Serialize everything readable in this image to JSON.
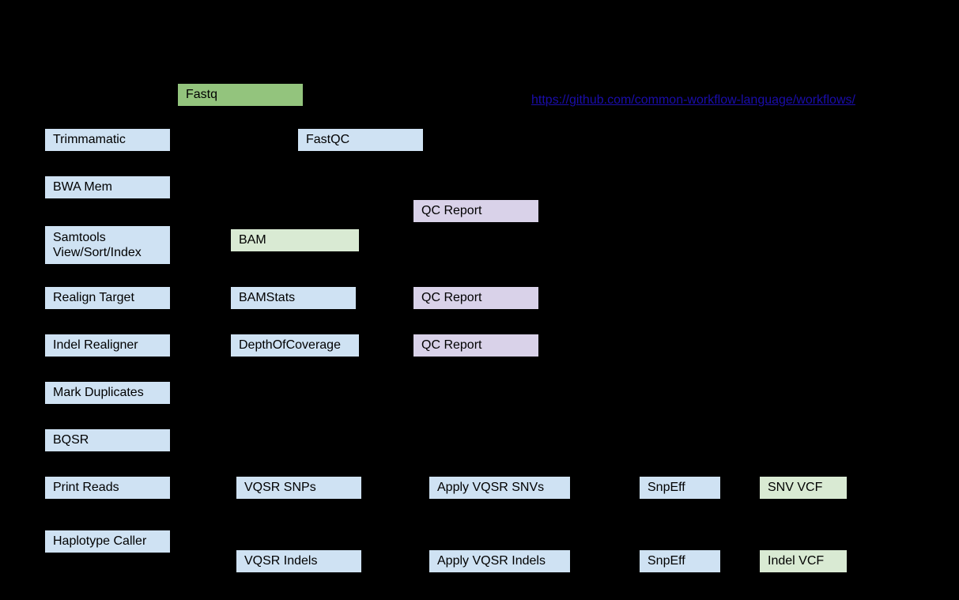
{
  "link": "https://github.com/common-workflow-language/workflows/",
  "nodes": {
    "fastq": "Fastq",
    "trimmamatic": "Trimmamatic",
    "fastqc": "FastQC",
    "bwa_mem": "BWA Mem",
    "qc_report1": "QC Report",
    "samtools": "Samtools View/Sort/Index",
    "bam": "BAM",
    "realign_target": "Realign Target",
    "bamstats": "BAMStats",
    "qc_report2": "QC Report",
    "indel_realigner": "Indel Realigner",
    "depth_of_coverage": "DepthOfCoverage",
    "qc_report3": "QC Report",
    "mark_duplicates": "Mark Duplicates",
    "bqsr": "BQSR",
    "print_reads": "Print Reads",
    "vqsr_snps": "VQSR SNPs",
    "apply_vqsr_snvs": "Apply VQSR SNVs",
    "snpeff1": "SnpEff",
    "snv_vcf": "SNV VCF",
    "haplotype_caller": "Haplotype Caller",
    "vqsr_indels": "VQSR Indels",
    "apply_vqsr_indels": "Apply VQSR Indels",
    "snpeff2": "SnpEff",
    "indel_vcf": "Indel VCF"
  }
}
